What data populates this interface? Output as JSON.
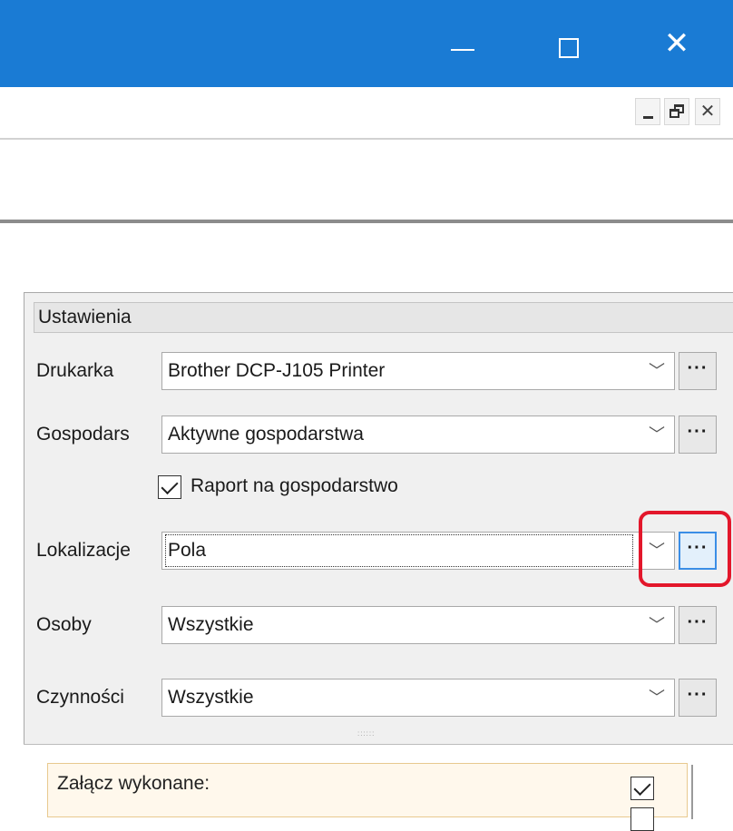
{
  "window": {
    "minimize_glyph": "",
    "close_glyph": "✕"
  },
  "mdi": {
    "close_glyph": "✕"
  },
  "settings": {
    "group_title": "Ustawienia",
    "fields": [
      {
        "label": "Drukarka",
        "value": "Brother DCP-J105 Printer"
      },
      {
        "label": "Gospodars",
        "value": "Aktywne gospodarstwa"
      },
      {
        "label": "Lokalizacje",
        "value": "Pola"
      },
      {
        "label": "Osoby",
        "value": "Wszystkie"
      },
      {
        "label": "Czynności",
        "value": "Wszystkie"
      }
    ],
    "dropdown_glyph": "﹀",
    "ellipsis_label": "···",
    "checkbox": {
      "label": "Raport na gospodarstwo",
      "checked": true
    },
    "highlight_color": "#e3172b"
  },
  "lower": {
    "attach_label": "Załącz wykonane:",
    "attach_checked": true
  },
  "colors": {
    "titlebar": "#1a7bd4",
    "focus_button_border": "#3a8ee6"
  }
}
